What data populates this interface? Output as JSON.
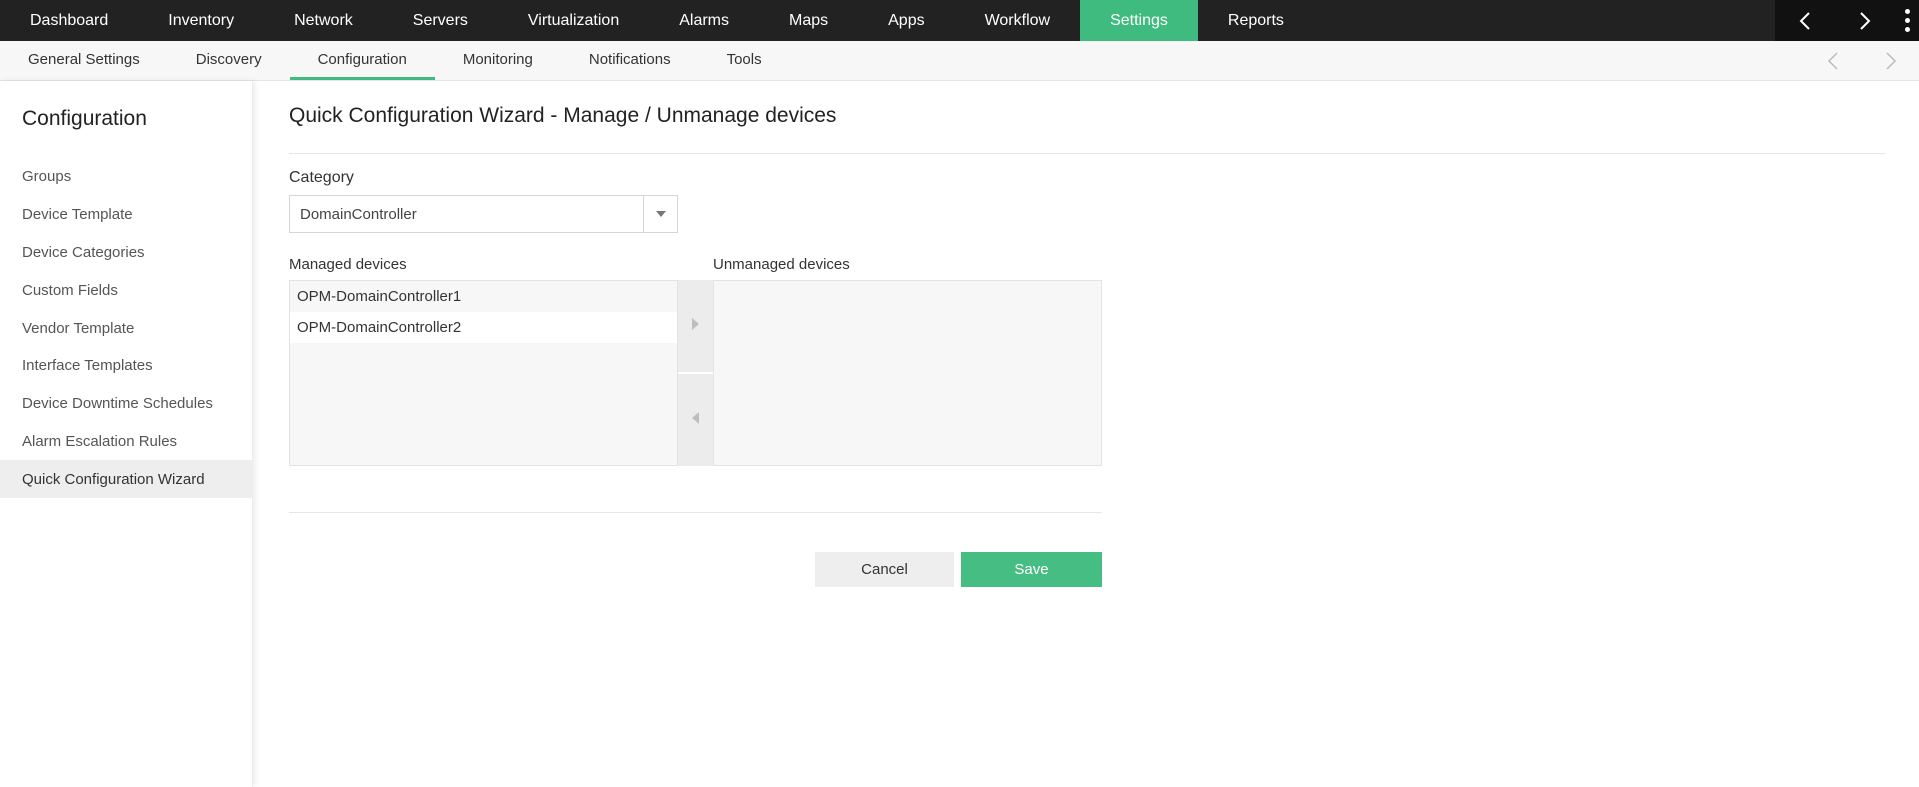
{
  "topnav": {
    "items": [
      "Dashboard",
      "Inventory",
      "Network",
      "Servers",
      "Virtualization",
      "Alarms",
      "Maps",
      "Apps",
      "Workflow",
      "Settings",
      "Reports"
    ],
    "active": "Settings",
    "accent": "#3fbb7f"
  },
  "subnav": {
    "items": [
      "General Settings",
      "Discovery",
      "Configuration",
      "Monitoring",
      "Notifications",
      "Tools"
    ],
    "active": "Configuration"
  },
  "sidebar": {
    "title": "Configuration",
    "items": [
      "Groups",
      "Device Template",
      "Device Categories",
      "Custom Fields",
      "Vendor Template",
      "Interface Templates",
      "Device Downtime Schedules",
      "Alarm Escalation Rules",
      "Quick Configuration Wizard"
    ],
    "active": "Quick Configuration Wizard"
  },
  "main": {
    "title": "Quick Configuration Wizard - Manage / Unmanage devices",
    "category_label": "Category",
    "category_value": "DomainController",
    "managed_label": "Managed devices",
    "unmanaged_label": "Unmanaged devices",
    "managed_devices": [
      "OPM-DomainController1",
      "OPM-DomainController2"
    ],
    "unmanaged_devices": [],
    "cancel_label": "Cancel",
    "save_label": "Save"
  },
  "icons": {
    "top_prev": "chevron-left-icon",
    "top_next": "chevron-right-icon",
    "more": "kebab-menu-icon",
    "sub_prev": "chevron-left-icon",
    "sub_next": "chevron-right-icon",
    "select_caret": "caret-down-icon",
    "move_right": "triangle-right-icon",
    "move_left": "triangle-left-icon"
  }
}
